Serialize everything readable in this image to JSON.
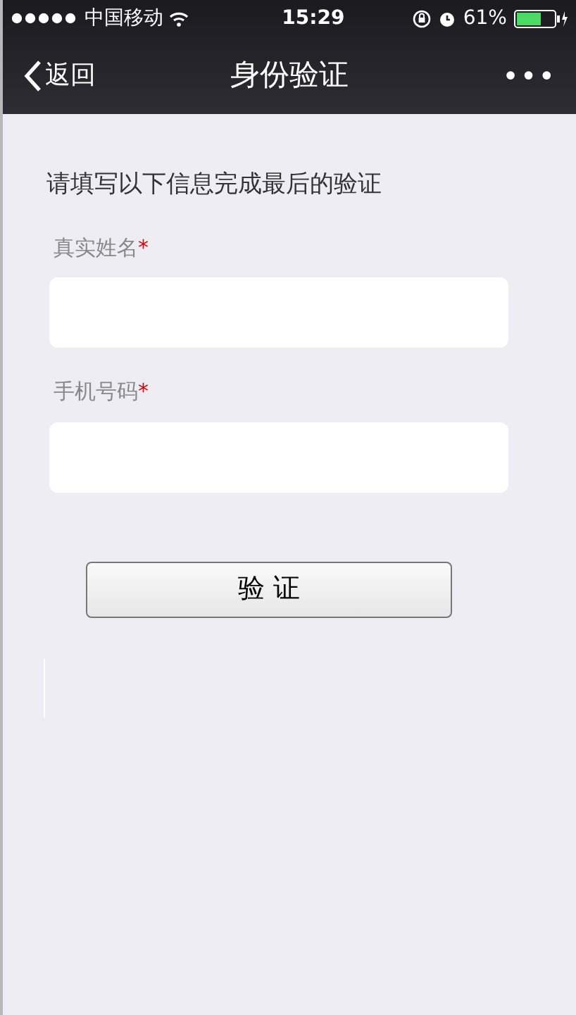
{
  "status_bar": {
    "carrier": "中国移动",
    "time": "15:29",
    "battery_percent": "61%"
  },
  "nav_bar": {
    "back": "返回",
    "title": "身份验证",
    "more": "•••"
  },
  "form": {
    "intro": "请填写以下信息完成最后的验证",
    "fields": [
      {
        "label": "真实姓名",
        "required_mark": "*"
      },
      {
        "label": "手机号码",
        "required_mark": "*"
      }
    ],
    "submit": "验 证"
  }
}
